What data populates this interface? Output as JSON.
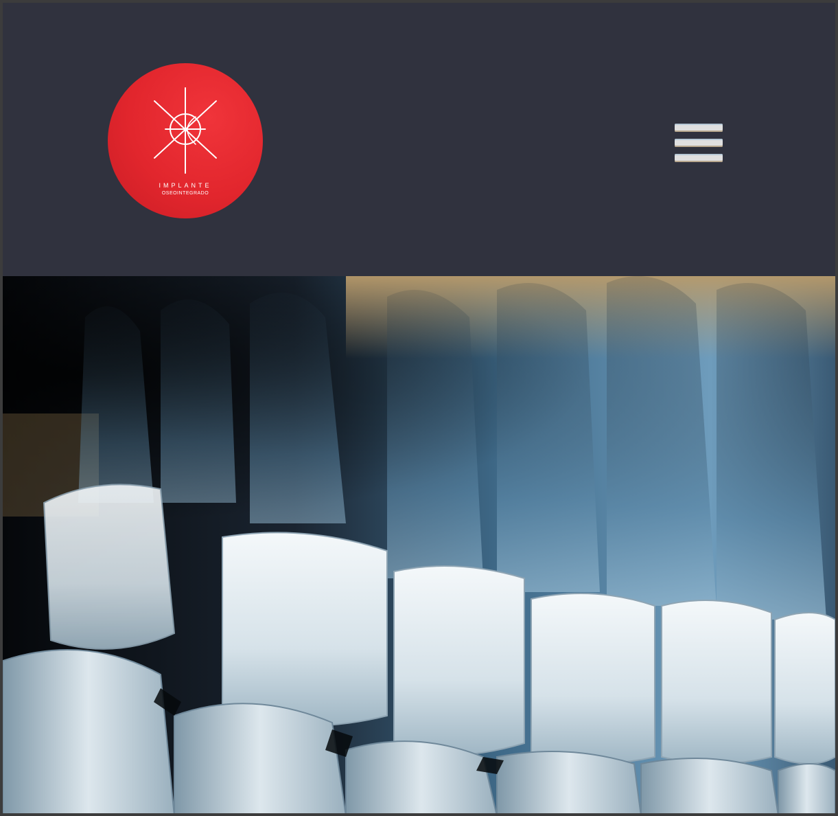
{
  "header": {
    "logo": {
      "name": "implante-logo",
      "line1": "IMPLANTE",
      "line2": "OSEOINTEGRADO",
      "color": "#e42a31"
    },
    "menu": {
      "icon": "hamburger-menu-icon"
    },
    "background": "#30323e"
  },
  "hero": {
    "image": "teeth-xray-3d-render",
    "colors": {
      "teeth": "#e4ecf0",
      "shadow": "#0b0e12",
      "blue": "#4a7fa0",
      "gold": "#a88a5c"
    }
  }
}
